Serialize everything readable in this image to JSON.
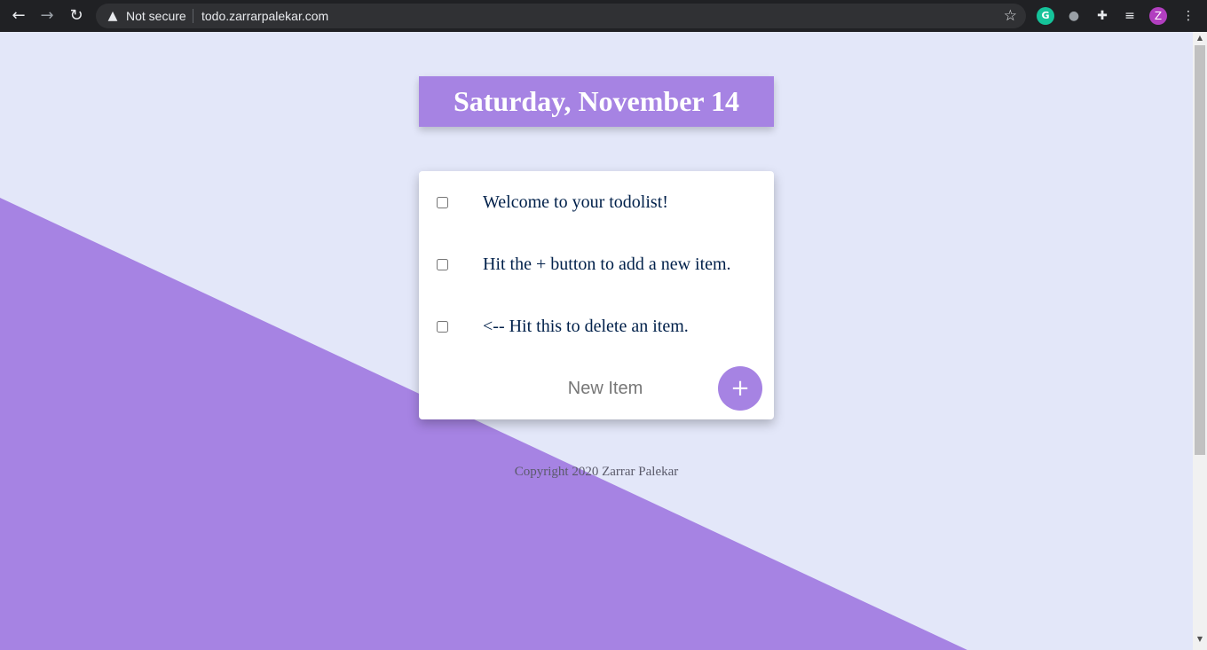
{
  "browser": {
    "security_label": "Not secure",
    "url": "todo.zarrarpalekar.com",
    "icons": [
      "back-arrow-icon",
      "forward-arrow-icon",
      "reload-icon",
      "warning-icon",
      "star-icon",
      "grammarly-icon",
      "extension-icon",
      "puzzle-icon",
      "media-queue-icon",
      "kebab-menu-icon"
    ],
    "profile_initial": "Z",
    "grammarly_letter": "G"
  },
  "colors": {
    "accent": "#a683e3",
    "page_background": "#e3e7f9",
    "item_text": "#00204a"
  },
  "heading": {
    "date": "Saturday, November 14"
  },
  "todo": {
    "items": [
      {
        "text": "Welcome to your todolist!",
        "checked": false
      },
      {
        "text": "Hit the + button to add a new item.",
        "checked": false
      },
      {
        "text": "<-- Hit this to delete an item.",
        "checked": false
      }
    ],
    "new_item_placeholder": "New Item",
    "add_button_label": "+"
  },
  "footer": {
    "copyright": "Copyright 2020 Zarrar Palekar"
  }
}
